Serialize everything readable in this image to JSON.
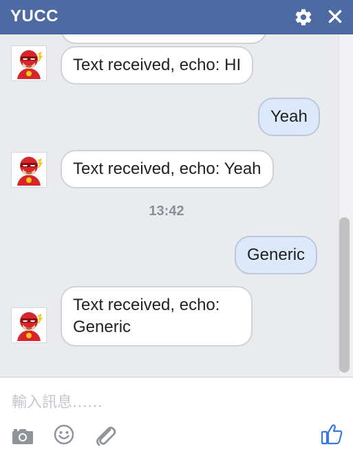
{
  "header": {
    "title": "YUCC"
  },
  "messages": [
    {
      "from": "bot",
      "text": "Text received, echo: HI"
    },
    {
      "from": "user",
      "text": "Yeah"
    },
    {
      "from": "bot",
      "text": "Text received, echo: Yeah"
    },
    {
      "from": "timestamp",
      "text": "13:42"
    },
    {
      "from": "user",
      "text": "Generic"
    },
    {
      "from": "bot",
      "line1": "Text received, echo:",
      "line2": "Generic"
    }
  ],
  "composer": {
    "placeholder": "輸入訊息……"
  },
  "icons": {
    "settings": "gear-icon",
    "close": "close-icon",
    "camera": "camera-icon",
    "emoji": "emoji-icon",
    "attach": "paperclip-icon",
    "like": "thumbs-up-icon"
  },
  "colors": {
    "header": "#4d6aa3",
    "outgoing_bubble": "#dce9fa",
    "incoming_bubble": "#ffffff",
    "like_icon": "#3578e5"
  }
}
